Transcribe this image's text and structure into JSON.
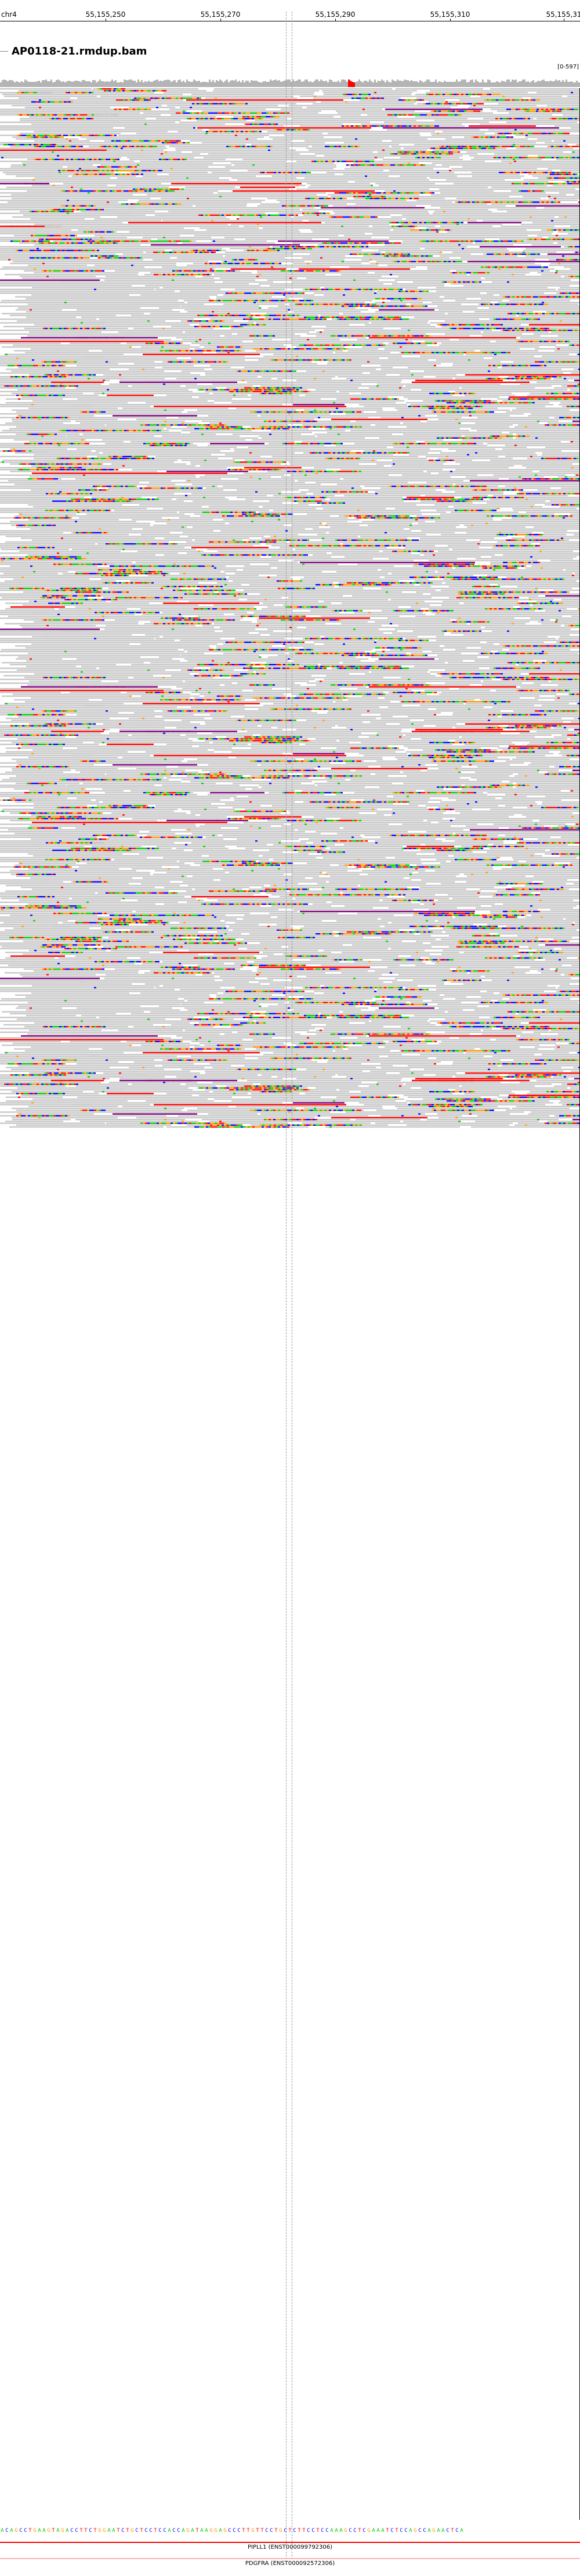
{
  "ruler": {
    "chromosome": "chr4",
    "positions": [
      "55,155,250",
      "55,155,270",
      "55,155,290",
      "55,155,310",
      "55,155,31"
    ]
  },
  "track": {
    "title": "AP0118-21.rmdup.bam",
    "data_range": "[0-597]"
  },
  "sequence": {
    "bases": "ACAGCCTGAAGTAGACCTTCTGGAATCTGCTCCTCCACCAGATAAGGAGCCCTTGTTCCTGCTCTTCCTCCAAAGCCTCGAAATCTCCAGCCAGAACTCA"
  },
  "genes": [
    {
      "label": "PIPLL1 (ENST000099792306)",
      "color": "#ff0000"
    },
    {
      "label": "PDGFRA (ENST000092572306)",
      "color": "#ffb3b3"
    }
  ],
  "colors": {
    "read": "#c8c8c8",
    "A": "#00cc00",
    "C": "#0000ff",
    "G": "#ff9900",
    "T": "#ff0000",
    "insert": "#800080"
  }
}
